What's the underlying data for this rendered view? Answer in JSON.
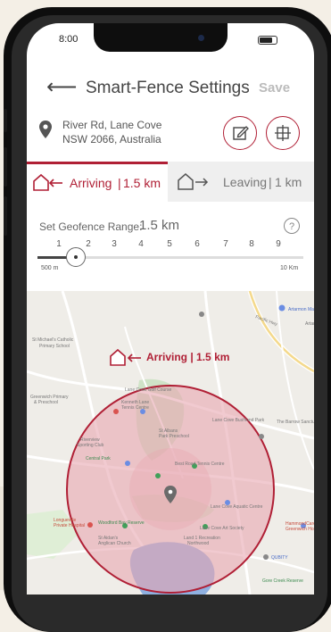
{
  "status_bar": {
    "time": "8:00"
  },
  "header": {
    "back_icon": "back-arrow-icon",
    "title": "Smart-Fence Settings",
    "save_label": "Save"
  },
  "location": {
    "icon": "map-pin-icon",
    "line1": "River Rd, Lane Cove",
    "line2": "NSW 2066, Australia"
  },
  "actions": [
    {
      "name": "edit-icon"
    },
    {
      "name": "target-icon"
    }
  ],
  "tabs": {
    "arriving": {
      "label": "Arriving",
      "distance": "1.5 km",
      "icon": "arrive-house-icon"
    },
    "leaving": {
      "label": "Leaving",
      "distance": "1 km",
      "icon": "leave-house-icon"
    }
  },
  "geofence": {
    "label": "Set Geofence Range:",
    "value": "1.5 km",
    "ticks": [
      "1",
      "2",
      "3",
      "4",
      "5",
      "6",
      "7",
      "8",
      "9"
    ],
    "min_label": "500 m",
    "max_label": "10 Km",
    "slider_value_km": 1.5
  },
  "map": {
    "badge": {
      "label": "Arriving",
      "distance": "1.5 km"
    },
    "places": [
      "Artarmon Marke",
      "Pacific Hwy",
      "Artarm",
      "St Michael's Catholic Primary School",
      "Lane Cove Golf Course",
      "Kenneth Lane Tennis Centre",
      "Lane Cove Bushland Park",
      "St Albans Park Preschool",
      "Greenwich Primary & Preschool",
      "Central Park",
      "Riverview Sporting Club",
      "Best Road Tennis Centre",
      "Lane Cove Aquatic Centre",
      "Lane Cove Art Society",
      "Longueville Private Hospital",
      "Woodford Bay Reserve",
      "St Aidan's Anglican Church",
      "Land 1 Recreation Northwood",
      "QUBITY",
      "Gore Creek Reserve",
      "Greenwich Hospital",
      "The Barrow Sanctuary"
    ]
  },
  "colors": {
    "accent": "#b01f35",
    "circle_fill": "#f1b9c1",
    "water": "#8fb0e0"
  }
}
